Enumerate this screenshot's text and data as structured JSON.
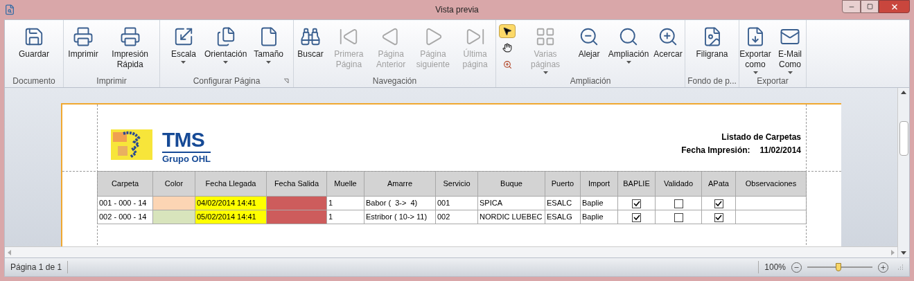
{
  "window": {
    "title": "Vista previa"
  },
  "ribbon": [
    {
      "label": "Documento",
      "buttons": [
        {
          "label": "Guardar",
          "disabled": false,
          "dropdown": false
        }
      ]
    },
    {
      "label": "Imprimir",
      "buttons": [
        {
          "label": "Imprimir",
          "disabled": false,
          "dropdown": false
        },
        {
          "label": "Impresión Rápida",
          "disabled": false,
          "dropdown": false
        }
      ]
    },
    {
      "label": "Configurar Página",
      "launcher": true,
      "buttons": [
        {
          "label": "Escala",
          "disabled": false,
          "dropdown": true
        },
        {
          "label": "Orientación",
          "disabled": false,
          "dropdown": true
        },
        {
          "label": "Tamaño",
          "disabled": false,
          "dropdown": true
        }
      ]
    },
    {
      "label": "Navegación",
      "buttons": [
        {
          "label": "Buscar",
          "disabled": false,
          "dropdown": false
        },
        {
          "label": "Primera Página",
          "disabled": true,
          "dropdown": false
        },
        {
          "label": "Página Anterior",
          "disabled": true,
          "dropdown": false
        },
        {
          "label": "Página siguiente",
          "disabled": true,
          "dropdown": false
        },
        {
          "label": "Última página",
          "disabled": true,
          "dropdown": false
        }
      ]
    },
    {
      "label": "Ampliación",
      "tools": [
        {
          "selected": true
        },
        {
          "selected": false
        },
        {
          "selected": false
        }
      ],
      "buttons": [
        {
          "label": "Varias páginas",
          "disabled": true,
          "dropdown": true
        },
        {
          "label": "Alejar",
          "disabled": false,
          "dropdown": false
        },
        {
          "label": "Ampliación",
          "disabled": false,
          "dropdown": true
        },
        {
          "label": "Acercar",
          "disabled": false,
          "dropdown": false
        }
      ]
    },
    {
      "label": "Fondo de p...",
      "buttons": [
        {
          "label": "Filigrana",
          "disabled": false,
          "dropdown": false
        }
      ]
    },
    {
      "label": "Exportar",
      "buttons": [
        {
          "label": "Exportar como",
          "disabled": false,
          "dropdown": true
        },
        {
          "label": "E-Mail Como",
          "disabled": false,
          "dropdown": true
        }
      ]
    }
  ],
  "report": {
    "logo": {
      "title": "TMS",
      "subtitle": "Grupo OHL"
    },
    "heading": "Listado de Carpetas",
    "date_label": "Fecha Impresión:",
    "date": "11/02/2014",
    "columns": [
      "Carpeta",
      "Color",
      "Fecha Llegada",
      "Fecha Salida",
      "Muelle",
      "Amarre",
      "Servicio",
      "Buque",
      "Puerto",
      "Import",
      "BAPLIE",
      "Validado",
      "APata",
      "Observaciones"
    ],
    "rows": [
      [
        {
          "kind": "text",
          "text": "001 - 000 - 14"
        },
        {
          "kind": "fill",
          "color": "#fcd5b4"
        },
        {
          "kind": "text",
          "text": "04/02/2014 14:41",
          "color": "#ffff00"
        },
        {
          "kind": "fill",
          "color": "#cd5c5c"
        },
        {
          "kind": "text",
          "text": "1"
        },
        {
          "kind": "text",
          "text": "Babor (  3->  4)"
        },
        {
          "kind": "text",
          "text": "001"
        },
        {
          "kind": "text",
          "text": "SPICA"
        },
        {
          "kind": "text",
          "text": "ESALC"
        },
        {
          "kind": "text",
          "text": "Baplie"
        },
        {
          "kind": "check",
          "checked": true
        },
        {
          "kind": "check",
          "checked": false
        },
        {
          "kind": "check",
          "checked": true
        },
        {
          "kind": "fill",
          "color": "#ffffff"
        }
      ],
      [
        {
          "kind": "text",
          "text": "002 - 000 - 14"
        },
        {
          "kind": "fill",
          "color": "#d8e4bc"
        },
        {
          "kind": "text",
          "text": "05/02/2014 14:41",
          "color": "#ffff00"
        },
        {
          "kind": "fill",
          "color": "#cd5c5c"
        },
        {
          "kind": "text",
          "text": "1"
        },
        {
          "kind": "text",
          "text": "Estribor ( 10-> 11)"
        },
        {
          "kind": "text",
          "text": "002"
        },
        {
          "kind": "text",
          "text": "NORDIC LUEBEC"
        },
        {
          "kind": "text",
          "text": "ESALG"
        },
        {
          "kind": "text",
          "text": "Baplie"
        },
        {
          "kind": "check",
          "checked": true
        },
        {
          "kind": "check",
          "checked": false
        },
        {
          "kind": "check",
          "checked": true
        },
        {
          "kind": "fill",
          "color": "#ffffff"
        }
      ]
    ]
  },
  "status_bar": {
    "page": "Página 1 de 1",
    "zoom": "100%",
    "zoom_slider": {
      "level": 0.48
    }
  }
}
